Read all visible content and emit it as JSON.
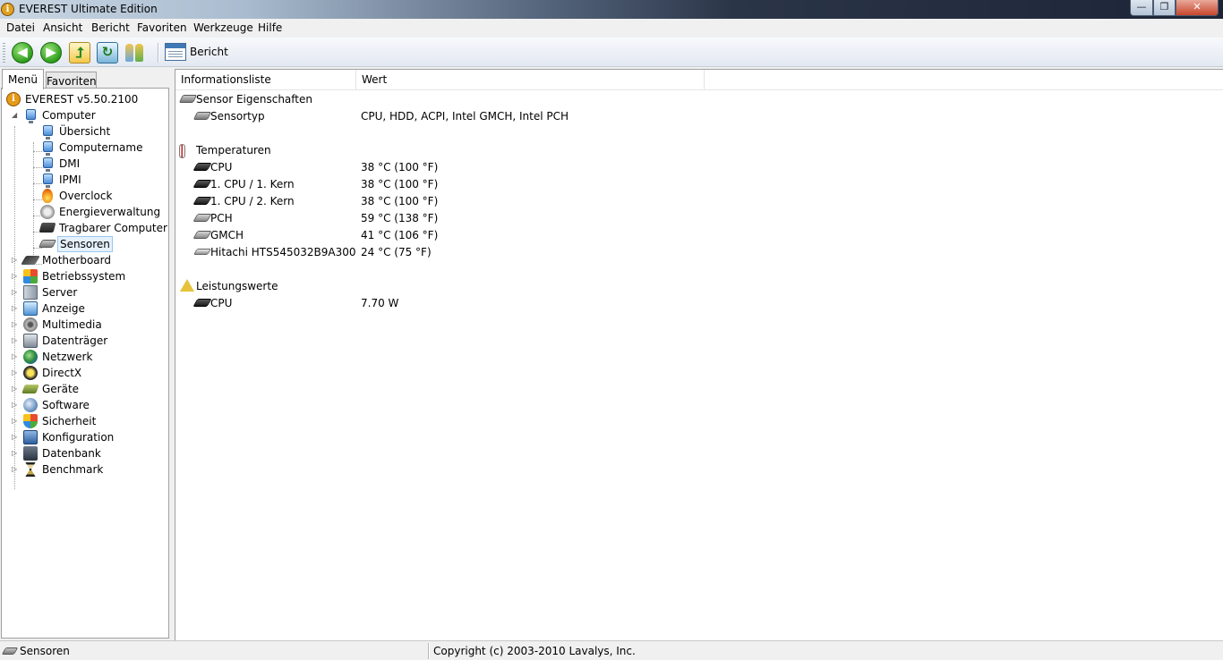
{
  "window": {
    "title": "EVEREST Ultimate Edition",
    "app_icon": "i",
    "min_glyph": "—",
    "max_glyph": "❐",
    "close_glyph": "✕"
  },
  "menubar": [
    "Datei",
    "Ansicht",
    "Bericht",
    "Favoriten",
    "Werkzeuge",
    "Hilfe"
  ],
  "toolbar": {
    "back_glyph": "◀",
    "forward_glyph": "▶",
    "up_glyph": "⮥",
    "refresh_glyph": "↻",
    "report_label": "Bericht"
  },
  "left_tabs": [
    "Menü",
    "Favoriten"
  ],
  "tree": {
    "root": {
      "label": "EVEREST v5.50.2100",
      "icon": "info-icon"
    },
    "computer": {
      "label": "Computer",
      "icon": "computer-icon"
    },
    "computer_children": [
      {
        "label": "Übersicht",
        "icon": "monitor-icon"
      },
      {
        "label": "Computername",
        "icon": "monitor-icon"
      },
      {
        "label": "DMI",
        "icon": "monitor-icon"
      },
      {
        "label": "IPMI",
        "icon": "monitor-icon"
      },
      {
        "label": "Overclock",
        "icon": "flame-icon"
      },
      {
        "label": "Energieverwaltung",
        "icon": "power-icon"
      },
      {
        "label": "Tragbarer Computer",
        "icon": "laptop-icon"
      },
      {
        "label": "Sensoren",
        "icon": "sensor-icon",
        "selected": true
      }
    ],
    "categories": [
      {
        "label": "Motherboard",
        "icon": "motherboard-icon"
      },
      {
        "label": "Betriebssystem",
        "icon": "windows-icon"
      },
      {
        "label": "Server",
        "icon": "server-icon"
      },
      {
        "label": "Anzeige",
        "icon": "display-icon"
      },
      {
        "label": "Multimedia",
        "icon": "speaker-icon"
      },
      {
        "label": "Datenträger",
        "icon": "drive-icon"
      },
      {
        "label": "Netzwerk",
        "icon": "globe-icon"
      },
      {
        "label": "DirectX",
        "icon": "directx-icon"
      },
      {
        "label": "Geräte",
        "icon": "devices-icon"
      },
      {
        "label": "Software",
        "icon": "software-icon"
      },
      {
        "label": "Sicherheit",
        "icon": "shield-icon"
      },
      {
        "label": "Konfiguration",
        "icon": "config-icon"
      },
      {
        "label": "Datenbank",
        "icon": "database-icon"
      },
      {
        "label": "Benchmark",
        "icon": "hourglass-icon"
      }
    ]
  },
  "list": {
    "columns": [
      "Informationsliste",
      "Wert"
    ],
    "groups": [
      {
        "title": "Sensor Eigenschaften",
        "icon": "sensor-icon",
        "items": [
          {
            "name": "Sensortyp",
            "value": "CPU, HDD, ACPI, Intel GMCH, Intel PCH",
            "icon": "sensor-icon"
          }
        ]
      },
      {
        "title": "Temperaturen",
        "icon": "thermometer-icon",
        "items": [
          {
            "name": "CPU",
            "value": "38 °C  (100 °F)",
            "icon": "cpu-icon"
          },
          {
            "name": "1. CPU / 1. Kern",
            "value": "38 °C  (100 °F)",
            "icon": "cpu-icon"
          },
          {
            "name": "1. CPU / 2. Kern",
            "value": "38 °C  (100 °F)",
            "icon": "cpu-icon"
          },
          {
            "name": "PCH",
            "value": "59 °C  (138 °F)",
            "icon": "chip-icon"
          },
          {
            "name": "GMCH",
            "value": "41 °C  (106 °F)",
            "icon": "chip-icon"
          },
          {
            "name": "Hitachi HTS545032B9A300",
            "value": "24 °C  (75 °F)",
            "icon": "hdd-icon"
          }
        ]
      },
      {
        "title": "Leistungswerte",
        "icon": "warning-icon",
        "items": [
          {
            "name": "CPU",
            "value": "7.70 W",
            "icon": "cpu-icon"
          }
        ]
      }
    ]
  },
  "statusbar": {
    "left": "Sensoren",
    "right": "Copyright (c) 2003-2010 Lavalys, Inc."
  }
}
